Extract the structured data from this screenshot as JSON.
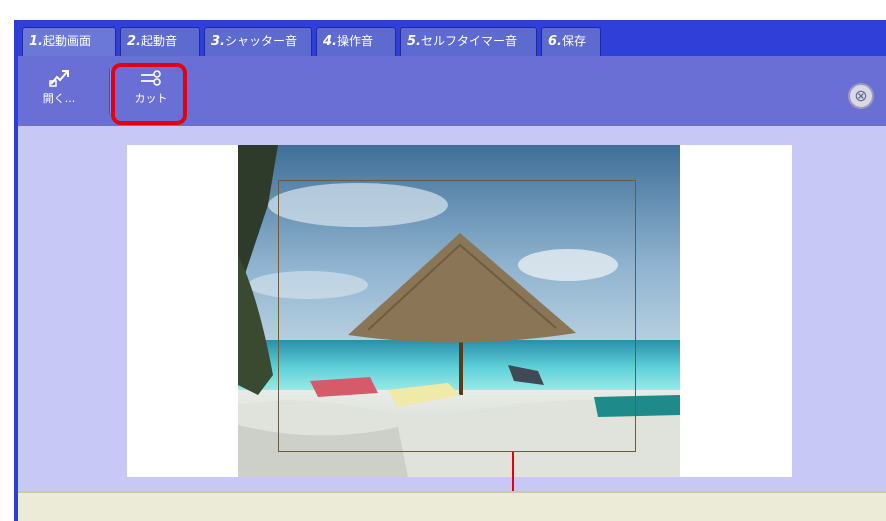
{
  "tabs": [
    {
      "num": "1.",
      "label": "起動画面"
    },
    {
      "num": "2.",
      "label": "起動音"
    },
    {
      "num": "3.",
      "label": "シャッター音"
    },
    {
      "num": "4.",
      "label": "操作音"
    },
    {
      "num": "5.",
      "label": "セルフタイマー音"
    },
    {
      "num": "6.",
      "label": "保存"
    }
  ],
  "toolbar": {
    "open_label": "開く...",
    "cut_label": "カット",
    "close_symbol": "⊗"
  },
  "colors": {
    "tabbar": "#2f3fd8",
    "toolbar": "#6a6fd6",
    "workspace": "#c7c8f6",
    "highlight": "#e3000f"
  },
  "icons": [
    "open-icon",
    "cut-icon",
    "close-icon"
  ]
}
